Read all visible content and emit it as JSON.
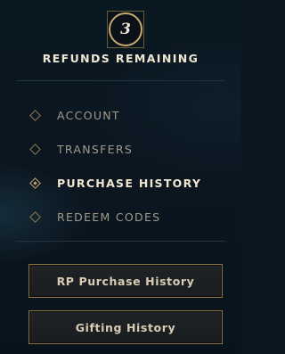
{
  "refunds": {
    "count": "3",
    "label": "REFUNDS REMAINING"
  },
  "nav": {
    "items": [
      {
        "label": "ACCOUNT",
        "active": false
      },
      {
        "label": "TRANSFERS",
        "active": false
      },
      {
        "label": "PURCHASE HISTORY",
        "active": true
      },
      {
        "label": "REDEEM CODES",
        "active": false
      }
    ]
  },
  "buttons": {
    "rp_purchase_history": "RP Purchase History",
    "gifting_history": "Gifting History"
  },
  "colors": {
    "gold": "#c8aa6e",
    "text_active": "#f0e6d2",
    "text_inactive": "#a09b8c",
    "background": "#0b1620"
  }
}
